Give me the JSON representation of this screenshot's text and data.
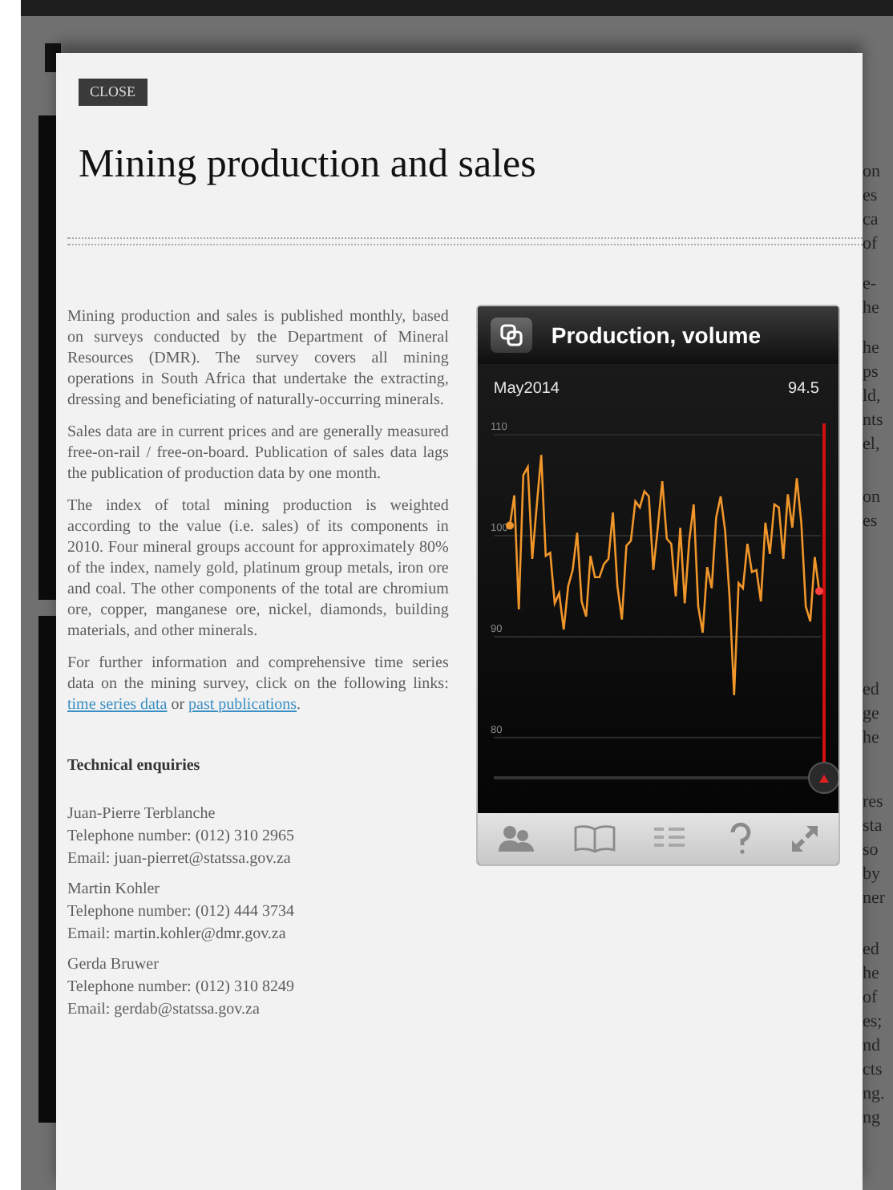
{
  "close_button": "CLOSE",
  "title": "Mining production and sales",
  "paragraphs": [
    "Mining production and sales is published monthly, based on surveys conducted by the Department of Mineral Resources (DMR). The survey covers all mining operations in South Africa that undertake the extracting, dressing and beneficiating of naturally-occurring minerals.",
    "Sales data are in current prices and are generally measured free-on-rail / free-on-board. Publication of sales data lags the publication of production data by one month.",
    "The index of total mining production is weighted according to the value (i.e. sales) of its components in 2010. Four mineral groups account for approximately 80% of the index, namely gold, platinum group metals, iron ore and coal. The other components of the total are chromium ore, copper, manganese ore, nickel, diamonds, building materials, and other minerals."
  ],
  "links_paragraph": {
    "text": "For further information and comprehensive time series data on the mining survey, click on the following links:",
    "links": [
      "time series data",
      "past publications"
    ],
    "joiner": "or",
    "end": "."
  },
  "enquiries_heading": "Technical enquiries",
  "contacts": [
    {
      "name": "Juan-Pierre Terblanche",
      "phone": "Telephone number: (012) 310 2965",
      "email": "Email: juan-pierret@statssa.gov.za"
    },
    {
      "name": "Martin Kohler",
      "phone": "Telephone number: (012) 444 3734",
      "email": "Email: martin.kohler@dmr.gov.za"
    },
    {
      "name": "Gerda Bruwer",
      "phone": "Telephone number: (012) 310 8249",
      "email": "Email: gerdab@statssa.gov.za"
    }
  ],
  "widget": {
    "date": "May2014",
    "reading": "94.5",
    "slider": {
      "level": 1
    },
    "chart_data": {
      "type": "line",
      "title": "Production, volume",
      "yticks": [
        80,
        90,
        100,
        110
      ],
      "ylim": [
        67.28,
        122.9
      ],
      "grid": true,
      "series": [
        {
          "color": "#f0962a",
          "values": [
            101,
            104,
            92.7,
            106,
            106.8,
            97.7,
            103,
            108,
            98,
            98.3,
            93.3,
            94.3,
            90.7,
            95,
            96.6,
            100.3,
            93.5,
            92,
            98,
            95.9,
            95.9,
            97.2,
            97.7,
            102.3,
            95,
            91.7,
            99,
            99.5,
            103.4,
            102.8,
            104.4,
            103.9,
            96.6,
            100.8,
            105.4,
            99.7,
            99.2,
            94,
            100.8,
            93.3,
            99.5,
            103.1,
            93,
            90.4,
            96.9,
            94.8,
            101.8,
            103.9,
            100.5,
            93.8,
            84.2,
            95.3,
            94.8,
            99.2,
            96.4,
            96.6,
            93.5,
            101.3,
            98.2,
            103.1,
            102.8,
            97.7,
            104.1,
            100.8,
            105.7,
            101.3,
            93,
            91.5,
            97.9,
            94.5
          ]
        }
      ]
    }
  },
  "toolbar": [
    {
      "kind": "people"
    },
    {
      "kind": "book"
    },
    {
      "kind": "codes"
    },
    {
      "kind": "help"
    },
    {
      "kind": "expand"
    }
  ],
  "background_fragments": [
    [
      "on",
      "es",
      "ca",
      "of"
    ],
    [
      "e-",
      "he"
    ],
    [
      "he",
      "ps",
      "ld,",
      "nts",
      "el,"
    ],
    [
      "on",
      "es"
    ],
    [
      "ed",
      "ge",
      "he"
    ],
    [
      "res",
      "sta",
      "so",
      "by",
      "ner"
    ],
    [
      "ed",
      "he",
      "of",
      "es;",
      "nd",
      "cts",
      "ng.",
      "ng"
    ]
  ]
}
